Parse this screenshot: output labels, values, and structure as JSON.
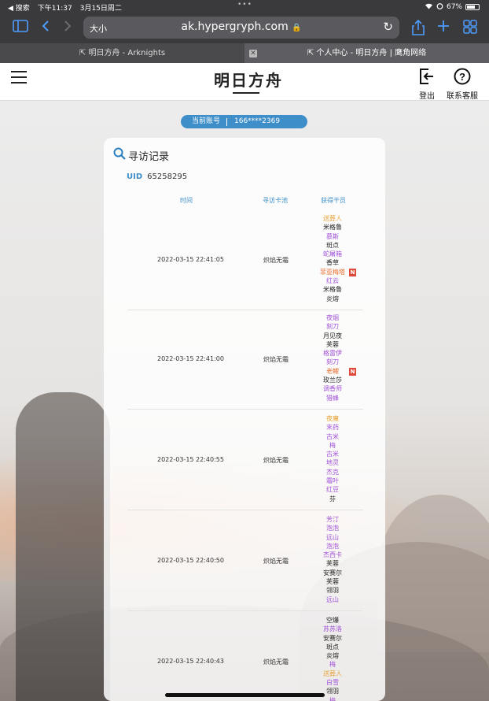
{
  "status_bar": {
    "back_label": "◀ 搜索",
    "time": "下午11:37",
    "date": "3月15日周二",
    "dots": "•••",
    "battery": "67%"
  },
  "toolbar": {
    "reader_label": "大小",
    "url": "ak.hypergryph.com"
  },
  "tabs": [
    {
      "title": "明日方舟 - Arknights"
    },
    {
      "title": "个人中心 - 明日方舟 | 鹰角网络"
    }
  ],
  "header": {
    "logo": "明日方舟",
    "logout_label": "登出",
    "support_label": "联系客服"
  },
  "account": {
    "label": "当前账号",
    "value": "166****2369"
  },
  "records": {
    "title": "寻访记录",
    "uid_label": "UID",
    "uid_value": "65258295",
    "columns": [
      "时间",
      "寻访卡池",
      "获得干员"
    ],
    "rows": [
      {
        "time": "2022-03-15 22:41:05",
        "pool": "炽焰无霜",
        "operators": [
          {
            "name": "送葬人",
            "rarity": 5,
            "new": false
          },
          {
            "name": "米格鲁",
            "rarity": 3,
            "new": false
          },
          {
            "name": "慕斯",
            "rarity": 4,
            "new": false
          },
          {
            "name": "斑点",
            "rarity": 3,
            "new": false
          },
          {
            "name": "蛇屠箱",
            "rarity": 4,
            "new": false
          },
          {
            "name": "香草",
            "rarity": 3,
            "new": false
          },
          {
            "name": "菲亚梅塔",
            "rarity": 6,
            "new": true
          },
          {
            "name": "红云",
            "rarity": 4,
            "new": false
          },
          {
            "name": "米格鲁",
            "rarity": 3,
            "new": false
          },
          {
            "name": "炎熔",
            "rarity": 3,
            "new": false
          }
        ]
      },
      {
        "time": "2022-03-15 22:41:00",
        "pool": "炽焰无霜",
        "operators": [
          {
            "name": "夜烟",
            "rarity": 4,
            "new": false
          },
          {
            "name": "刻刀",
            "rarity": 4,
            "new": false
          },
          {
            "name": "月见夜",
            "rarity": 3,
            "new": false
          },
          {
            "name": "芙蓉",
            "rarity": 3,
            "new": false
          },
          {
            "name": "格雷伊",
            "rarity": 4,
            "new": false
          },
          {
            "name": "刻刀",
            "rarity": 4,
            "new": false
          },
          {
            "name": "老鲤",
            "rarity": 6,
            "new": true
          },
          {
            "name": "玫兰莎",
            "rarity": 3,
            "new": false
          },
          {
            "name": "调香师",
            "rarity": 4,
            "new": false
          },
          {
            "name": "猎蜂",
            "rarity": 4,
            "new": false
          }
        ]
      },
      {
        "time": "2022-03-15 22:40:55",
        "pool": "炽焰无霜",
        "operators": [
          {
            "name": "夜魔",
            "rarity": 5,
            "new": false
          },
          {
            "name": "末药",
            "rarity": 4,
            "new": false
          },
          {
            "name": "古米",
            "rarity": 4,
            "new": false
          },
          {
            "name": "梅",
            "rarity": 4,
            "new": false
          },
          {
            "name": "古米",
            "rarity": 4,
            "new": false
          },
          {
            "name": "地灵",
            "rarity": 4,
            "new": false
          },
          {
            "name": "杰克",
            "rarity": 4,
            "new": false
          },
          {
            "name": "霜叶",
            "rarity": 4,
            "new": false
          },
          {
            "name": "红豆",
            "rarity": 4,
            "new": false
          },
          {
            "name": "芬",
            "rarity": 3,
            "new": false
          }
        ]
      },
      {
        "time": "2022-03-15 22:40:50",
        "pool": "炽焰无霜",
        "operators": [
          {
            "name": "芳汀",
            "rarity": 4,
            "new": false
          },
          {
            "name": "泡泡",
            "rarity": 4,
            "new": false
          },
          {
            "name": "远山",
            "rarity": 4,
            "new": false
          },
          {
            "name": "泡泡",
            "rarity": 4,
            "new": false
          },
          {
            "name": "杰西卡",
            "rarity": 4,
            "new": false
          },
          {
            "name": "芙蓉",
            "rarity": 3,
            "new": false
          },
          {
            "name": "安赛尔",
            "rarity": 3,
            "new": false
          },
          {
            "name": "芙蓉",
            "rarity": 3,
            "new": false
          },
          {
            "name": "翎羽",
            "rarity": 3,
            "new": false
          },
          {
            "name": "远山",
            "rarity": 4,
            "new": false
          }
        ]
      },
      {
        "time": "2022-03-15 22:40:43",
        "pool": "炽焰无霜",
        "operators": [
          {
            "name": "空爆",
            "rarity": 3,
            "new": false
          },
          {
            "name": "苏苏洛",
            "rarity": 4,
            "new": false
          },
          {
            "name": "安赛尔",
            "rarity": 3,
            "new": false
          },
          {
            "name": "斑点",
            "rarity": 3,
            "new": false
          },
          {
            "name": "炎熔",
            "rarity": 3,
            "new": false
          },
          {
            "name": "梅",
            "rarity": 4,
            "new": false
          },
          {
            "name": "送葬人",
            "rarity": 5,
            "new": false
          },
          {
            "name": "白雪",
            "rarity": 4,
            "new": false
          },
          {
            "name": "翎羽",
            "rarity": 3,
            "new": false
          },
          {
            "name": "梅",
            "rarity": 4,
            "new": false
          }
        ]
      }
    ],
    "new_badge": "N"
  },
  "rarity_colors": {
    "3": "#222222",
    "4": "#a050d8",
    "5": "#e8a030",
    "6": "#e86a2a"
  }
}
